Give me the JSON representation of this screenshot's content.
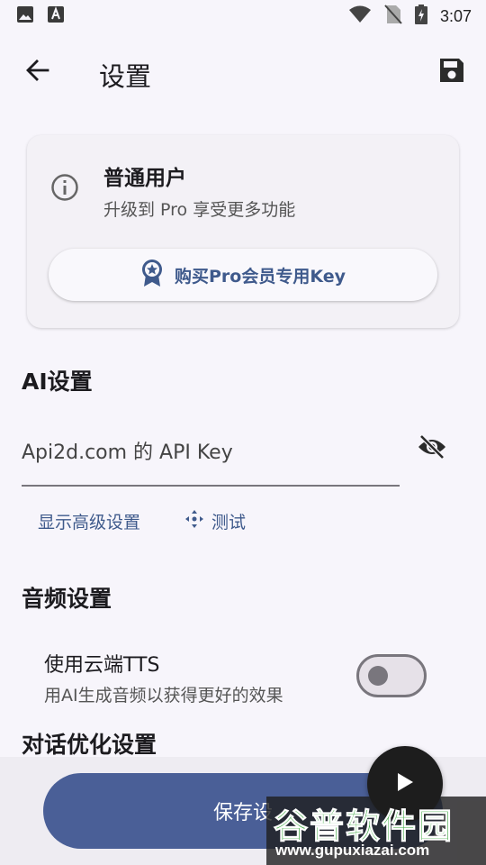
{
  "status_bar": {
    "time": "3:07",
    "left_icons": [
      "image-icon",
      "font-icon"
    ],
    "right_icons": [
      "wifi-icon",
      "no-sim-icon",
      "battery-charging-icon"
    ]
  },
  "app_bar": {
    "title": "设置",
    "back_icon": "arrow-left-icon",
    "save_icon": "floppy-disk-icon"
  },
  "user_card": {
    "title": "普通用户",
    "subtitle": "升级到 Pro 享受更多功能",
    "buy_button": "购买Pro会员专用Key"
  },
  "ai_section": {
    "title": "AI设置",
    "api_key_label": "Api2d.com 的 API Key",
    "show_advanced": "显示高级设置",
    "test": "测试"
  },
  "audio_section": {
    "title": "音频设置",
    "cloud_tts_title": "使用云端TTS",
    "cloud_tts_sub": "用AI生成音频以获得更好的效果",
    "cloud_tts_enabled": false
  },
  "dialog_section": {
    "title": "对话优化设置"
  },
  "bottom": {
    "save_label": "保存设"
  },
  "watermark": {
    "title": "谷普软件园",
    "url": "www.gupuxiazai.com"
  },
  "colors": {
    "primary": "#4a5f97",
    "link": "#3f5a8c",
    "background": "#f7f5fb"
  }
}
